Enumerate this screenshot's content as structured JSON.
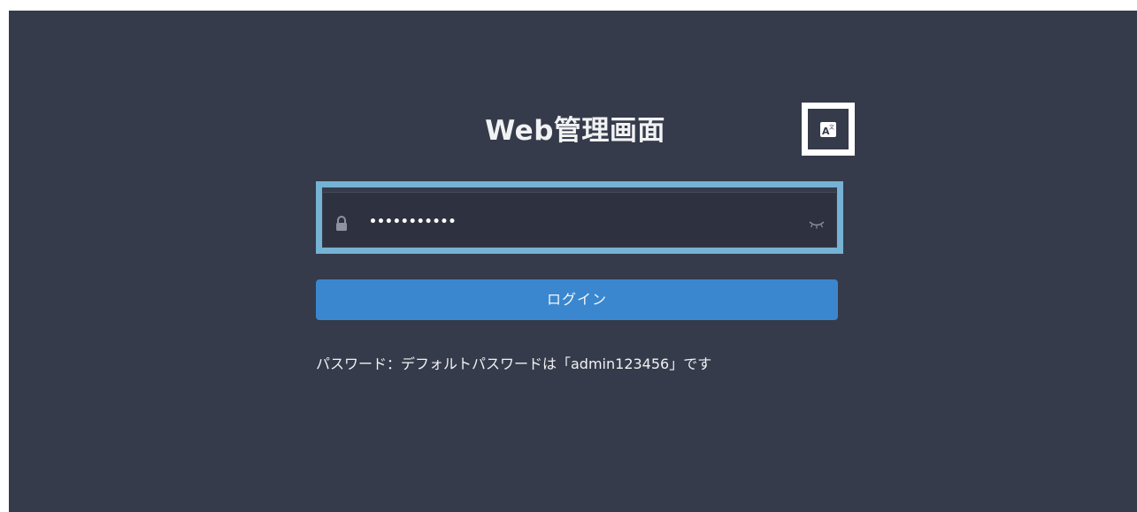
{
  "page": {
    "title": "Web管理画面",
    "colors": {
      "background": "#353b4a",
      "field_background": "#2e3240",
      "focus_border": "#75b2d4",
      "button": "#3a87cf",
      "text": "#f1f2f4"
    }
  },
  "language_button": {
    "icon": "translate-icon"
  },
  "password_field": {
    "value": "•••••••••••",
    "leading_icon": "lock-icon",
    "trailing_icon": "eye-closed-icon"
  },
  "login_button": {
    "label": "ログイン"
  },
  "hint": {
    "text": "パスワード：デフォルトパスワードは「admin123456」です"
  }
}
